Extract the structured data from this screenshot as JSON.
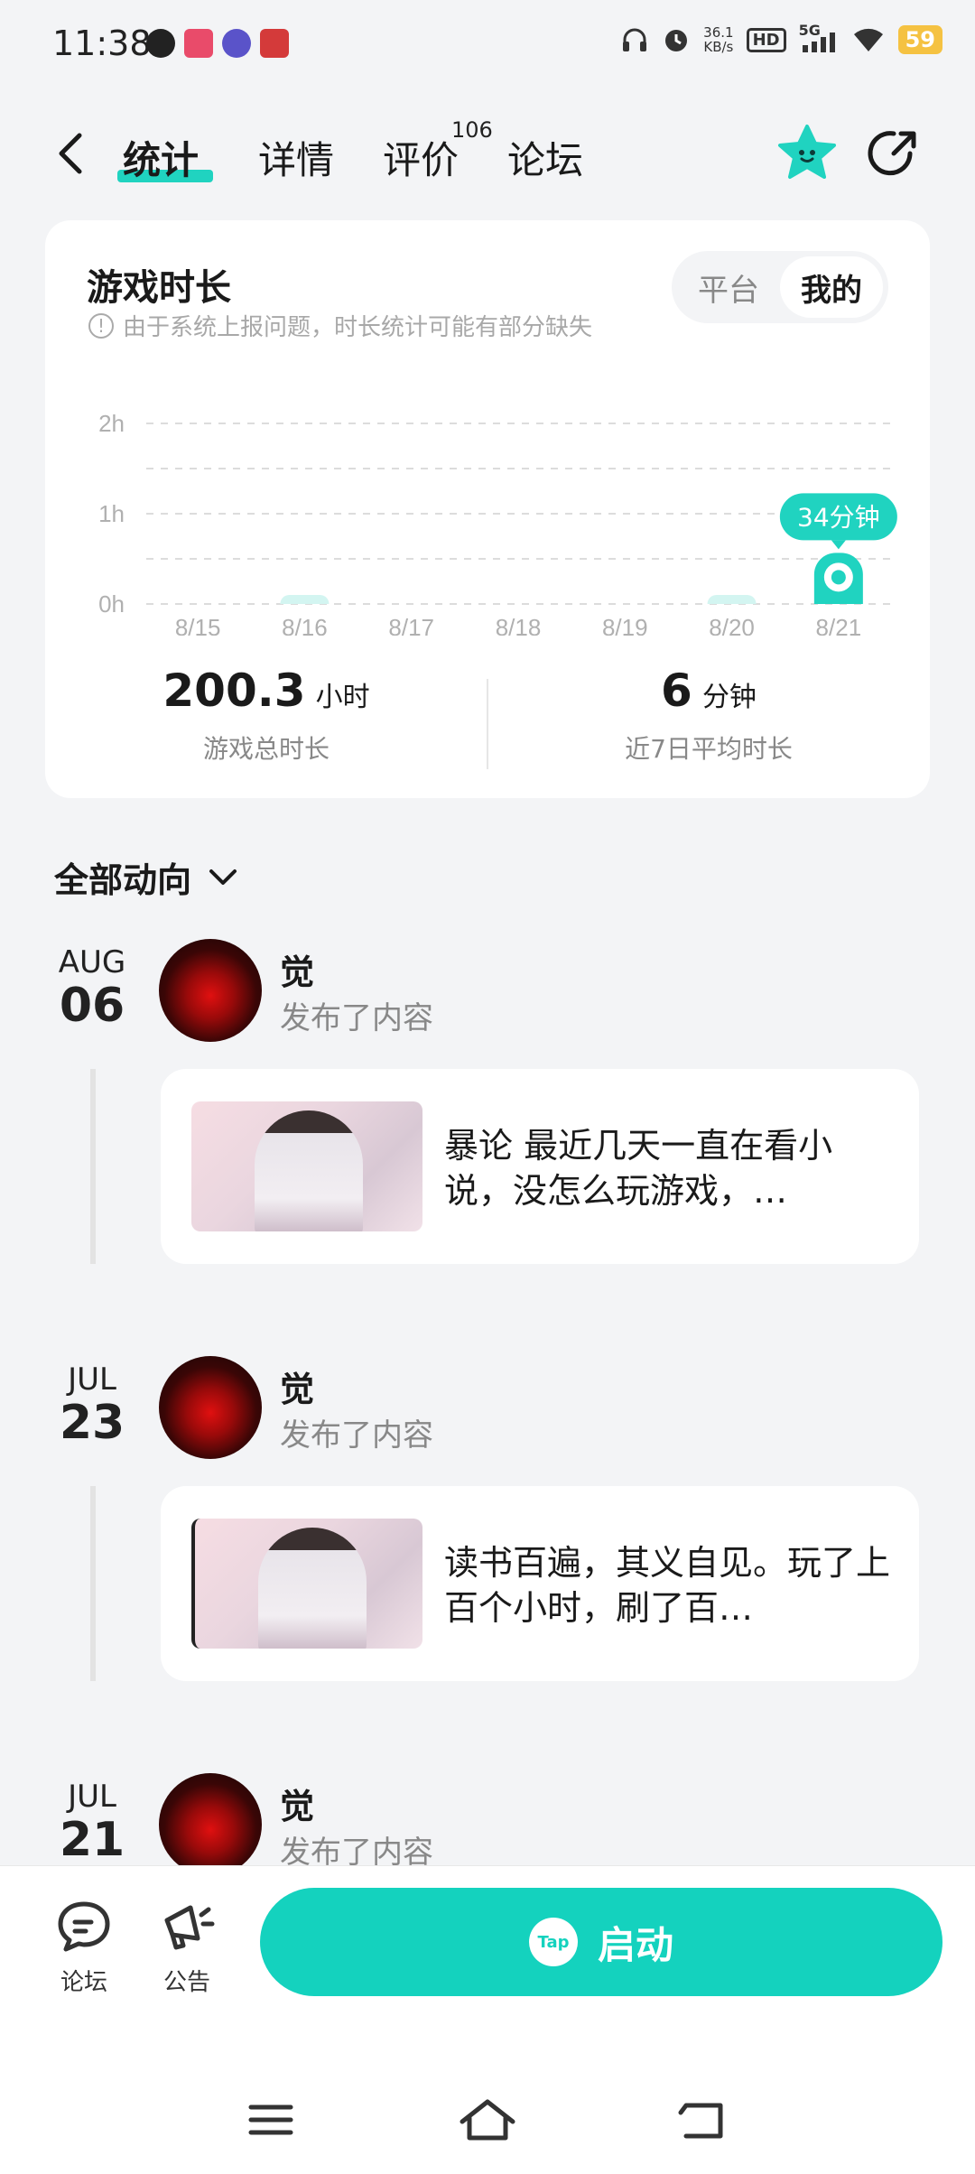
{
  "status_bar": {
    "time": "11:38",
    "net_speed_value": "36.1",
    "net_speed_unit": "KB/s",
    "hd": "HD",
    "network": "5G",
    "battery": "59"
  },
  "nav": {
    "tabs": [
      {
        "label": "统计",
        "active": true
      },
      {
        "label": "详情",
        "active": false
      },
      {
        "label": "评价",
        "active": false
      },
      {
        "label": "论坛",
        "active": false
      }
    ],
    "review_count": "106"
  },
  "stats": {
    "title": "游戏时长",
    "notice": "由于系统上报问题，时长统计可能有部分缺失",
    "toggle": [
      "平台",
      "我的"
    ],
    "toggle_selected": "我的",
    "total_value": "200.3",
    "total_unit": "小时",
    "total_label": "游戏总时长",
    "avg_value": "6",
    "avg_unit": "分钟",
    "avg_label": "近7日平均时长",
    "accent_color": "#20d3c0"
  },
  "chart_data": {
    "type": "bar",
    "categories": [
      "8/15",
      "8/16",
      "8/17",
      "8/18",
      "8/19",
      "8/20",
      "8/21"
    ],
    "values_minutes": [
      0,
      1,
      0,
      0,
      0,
      1,
      34
    ],
    "y_ticks": [
      "2h",
      "1h",
      "0h"
    ],
    "ylim_minutes": [
      0,
      120
    ],
    "highlight_label": "34分钟",
    "highlight_index": 6,
    "grid": true
  },
  "feed": {
    "header": "全部动向",
    "entries": [
      {
        "month": "AUG",
        "day": "06",
        "author": "觉",
        "action": "发布了内容",
        "text": "暴论 最近几天一直在看小说，没怎么玩游戏，…"
      },
      {
        "month": "JUL",
        "day": "23",
        "author": "觉",
        "action": "发布了内容",
        "text": "读书百遍，其义自见。玩了上百个小时，刷了百…"
      },
      {
        "month": "JUL",
        "day": "21",
        "author": "觉",
        "action": "发布了内容"
      }
    ]
  },
  "bottom": {
    "forum_label": "论坛",
    "notice_label": "公告",
    "launch_label": "启动",
    "tap_logo": "Tap"
  }
}
